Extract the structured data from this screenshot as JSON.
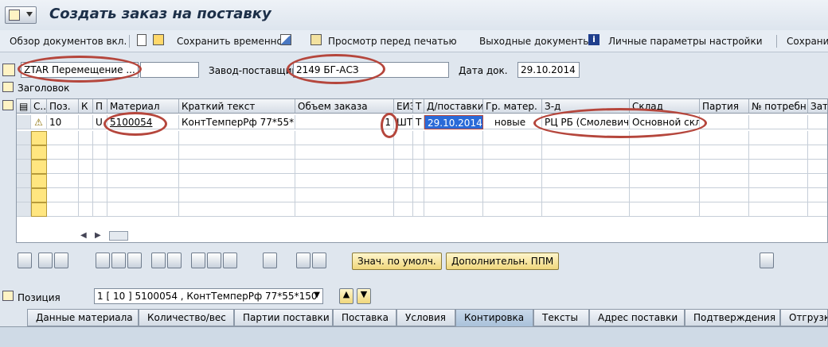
{
  "window": {
    "title": "Создать заказ на поставку"
  },
  "toolbar": {
    "overview": "Обзор документов вкл.",
    "save_temp": "Сохранить временно",
    "print_preview": "Просмотр перед печатью",
    "output_docs": "Выходные документы",
    "personal_settings": "Личные параметры настройки",
    "save": "Сохранит"
  },
  "header": {
    "order_type": "ZTAR Перемещение ...",
    "plant_label": "Завод-поставщик",
    "plant_value": "2149 БГ-АСЗ",
    "date_label": "Дата док.",
    "date_value": "29.10.2014",
    "header_label": "Заголовок"
  },
  "grid": {
    "columns": [
      "С...",
      "Поз.",
      "К",
      "П",
      "Материал",
      "Краткий текст",
      "Объем заказа",
      "ЕИЗ",
      "Т",
      "Д/поставки",
      "Гр. матер.",
      "З-д",
      "Склад",
      "Партия",
      "№ потребн.",
      "Затр"
    ],
    "row1": {
      "pos": "10",
      "p": "U",
      "material": "5100054",
      "short_text": "КонтТемперРф 77*55*...",
      "qty": "1",
      "uom": "ШТ",
      "t": "Т",
      "delivery_date": "29.10.2014",
      "mat_group": "новые",
      "plant": "РЦ РБ (Смолевич...",
      "storage": "Основной скл..."
    }
  },
  "buttons": {
    "defaults": "Знач. по умолч.",
    "additional": "Дополнительн. ППМ"
  },
  "item": {
    "label": "Позиция",
    "value": "1 [ 10 ] 5100054 , КонтТемперРф 77*55*150"
  },
  "tabs": [
    "Данные материала",
    "Количество/вес",
    "Партии поставки",
    "Поставка",
    "Условия",
    "Контировка",
    "Тексты",
    "Адрес поставки",
    "Подтверждения",
    "Отгрузка"
  ]
}
